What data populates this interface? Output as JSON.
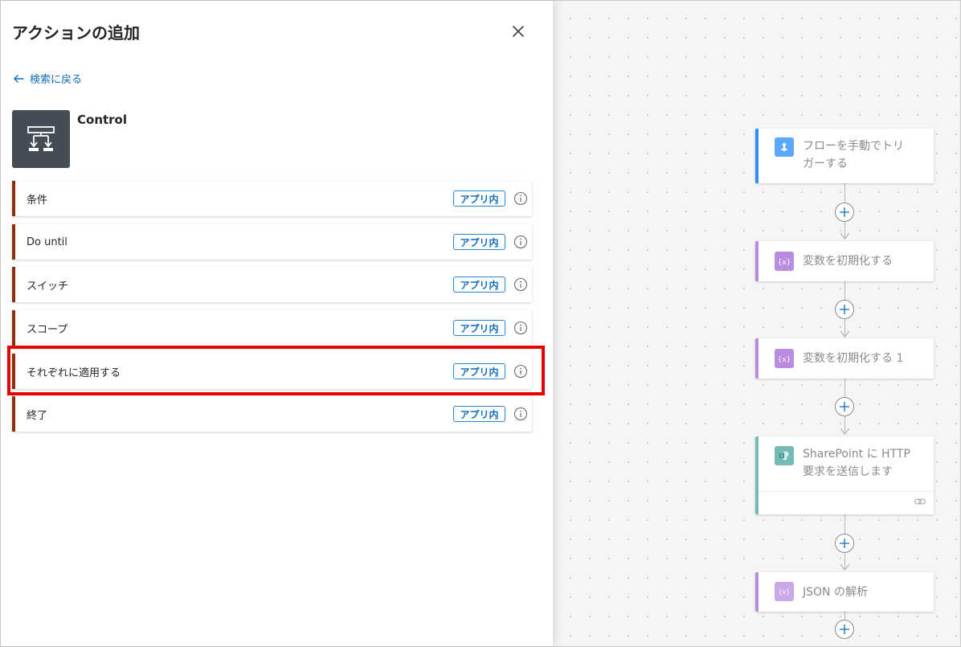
{
  "panel": {
    "title": "アクションの追加",
    "back_label": "検索に戻る",
    "connector_name": "Control",
    "accent_color": "#8b2f0c",
    "actions": [
      {
        "label": "条件",
        "badge": "アプリ内"
      },
      {
        "label": "Do until",
        "badge": "アプリ内"
      },
      {
        "label": "スイッチ",
        "badge": "アプリ内"
      },
      {
        "label": "スコープ",
        "badge": "アプリ内"
      },
      {
        "label": "それぞれに適用する",
        "badge": "アプリ内"
      },
      {
        "label": "終了",
        "badge": "アプリ内"
      }
    ]
  },
  "canvas": {
    "cards": [
      {
        "title_line1": "フローを手動でトリ",
        "title_line2": "ガーする",
        "icon": "manual-trigger-icon",
        "color": "#1f85ff"
      },
      {
        "title_line1": "変数を初期化する",
        "icon": "variable-icon",
        "color": "#770bd6"
      },
      {
        "title_line1": "変数を初期化する 1",
        "icon": "variable-icon",
        "color": "#770bd6"
      },
      {
        "title_line1": "SharePoint に HTTP",
        "title_line2": "要求を送信します",
        "icon": "sharepoint-icon",
        "color": "#036c70"
      },
      {
        "title_line1": "JSON の解析",
        "icon": "json-parse-icon",
        "color": "#770bd6"
      }
    ]
  },
  "highlight_color": "#e60000"
}
